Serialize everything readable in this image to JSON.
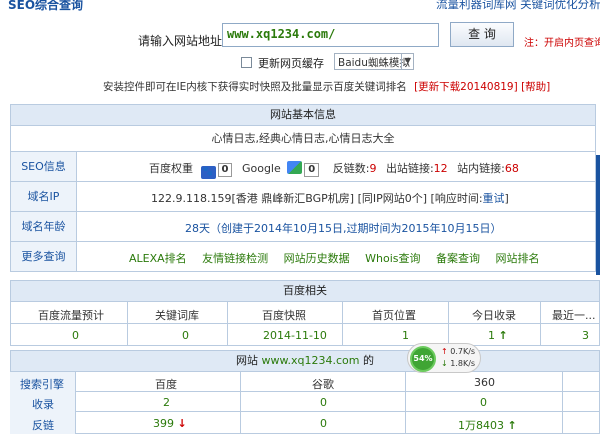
{
  "header": {
    "title": "SEO综合查询",
    "links": "流量利器词库网  关键词优化分析"
  },
  "query": {
    "url_label": "请输入网站地址：",
    "url_value": "www.xq1234.com/",
    "button_label": "查 询",
    "note": "注：开启内页查询",
    "cache_label": "更新网页缓存",
    "spider_selected": "Baidu蜘蛛模拟",
    "install_prefix": "安装控件即可在IE内核下获得实时快照及批量显示百度关键词排名",
    "download_link": "[更新下载20140819]",
    "help_link": "[帮助]"
  },
  "basic": {
    "heading": "网站基本信息",
    "site_title": "心情日志,经典心情日志,心情日志大全",
    "seo": {
      "label": "SEO信息",
      "baidu_weight_label": "百度权重",
      "baidu_weight": "0",
      "google_label": "Google",
      "google_pr": "0",
      "backlinks_label": "反链数:",
      "backlinks": "9",
      "outbound_label": "出站链接:",
      "outbound": "12",
      "internal_label": "站内链接:",
      "internal": "68"
    },
    "ip": {
      "label": "域名IP",
      "value": "122.9.118.159[香港 鼎峰新汇BGP机房]",
      "same_ip": "[同IP网站0个]",
      "response_label": "[响应时间:",
      "retest": "重试",
      "response_close": "]"
    },
    "age": {
      "label": "域名年龄",
      "value": "28天（创建于2014年10月15日,过期时间为2015年10月15日）"
    },
    "more": {
      "label": "更多查询",
      "links": [
        "ALEXA排名",
        "友情链接检测",
        "网站历史数据",
        "Whois查询",
        "备案查询",
        "网站排名"
      ]
    }
  },
  "baidu": {
    "heading": "百度相关",
    "columns": [
      "百度流量预计",
      "关键词库",
      "百度快照",
      "首页位置",
      "今日收录",
      "最近一..."
    ],
    "values": [
      "0",
      "0",
      "2014-11-10",
      "1",
      "1",
      "3"
    ]
  },
  "engines": {
    "heading_prefix": "网站",
    "heading_domain": "www.xq1234.com",
    "heading_suffix": "的",
    "columns": [
      "搜索引擎",
      "百度",
      "谷歌",
      "360"
    ],
    "rows": [
      {
        "label": "收录",
        "baidu": "2",
        "google": "0",
        "s360": "0"
      },
      {
        "label": "反链",
        "baidu": "399",
        "google": "0",
        "s360": "1万8403"
      }
    ]
  },
  "speed_widget": {
    "percent": "54%",
    "up": "0.7K/s",
    "down": "1.8K/s"
  },
  "colors": {
    "link_blue": "#1a53a0",
    "value_green": "#2b7a0b",
    "alert_red": "#cc0000",
    "header_bg": "#dfe9f5"
  }
}
